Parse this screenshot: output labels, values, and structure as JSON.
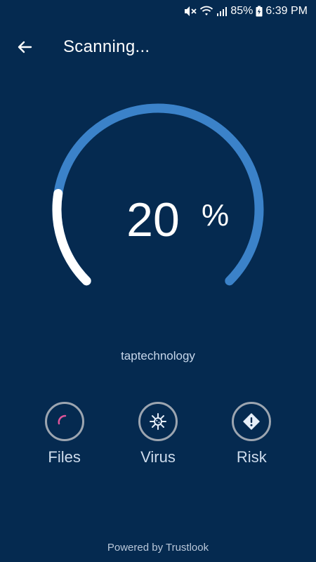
{
  "status_bar": {
    "battery": "85%",
    "time": "6:39 PM"
  },
  "toolbar": {
    "title": "Scanning...",
    "back_icon": "arrow-left-icon"
  },
  "scan": {
    "percent": "20",
    "percent_sign": "%",
    "progress_fraction": 0.2,
    "current_item": "taptechnology"
  },
  "categories": [
    {
      "label": "Files",
      "icon": "spinner-icon"
    },
    {
      "label": "Virus",
      "icon": "virus-icon"
    },
    {
      "label": "Risk",
      "icon": "warning-diamond-icon"
    }
  ],
  "footer": {
    "powered_by": "Powered by Trustlook"
  },
  "colors": {
    "background": "#052a50",
    "gauge_track": "#3b82c9",
    "gauge_progress": "#ffffff",
    "spinner": "#e0559a"
  }
}
